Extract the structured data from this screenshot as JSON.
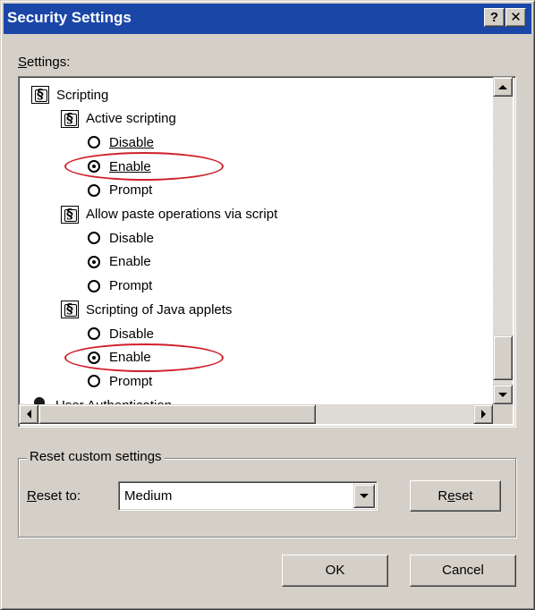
{
  "window": {
    "title": "Security Settings",
    "help_button": "?",
    "close_button": "✕"
  },
  "settings_label": {
    "u": "S",
    "rest": "ettings:"
  },
  "tree": [
    {
      "kind": "category",
      "icon": "script-settings-icon",
      "label": "Scripting"
    },
    {
      "kind": "setting",
      "icon": "script-settings-icon",
      "label": "Active scripting"
    },
    {
      "kind": "option",
      "label": "Disable",
      "underline": "D",
      "checked": false
    },
    {
      "kind": "option",
      "label": "Enable",
      "underline": "E",
      "checked": true,
      "highlighted": true
    },
    {
      "kind": "option",
      "label": "Prompt",
      "underline": "",
      "checked": false
    },
    {
      "kind": "setting",
      "icon": "script-settings-icon",
      "label": "Allow paste operations via script"
    },
    {
      "kind": "option",
      "label": "Disable",
      "underline": "",
      "checked": false
    },
    {
      "kind": "option",
      "label": "Enable",
      "underline": "",
      "checked": true
    },
    {
      "kind": "option",
      "label": "Prompt",
      "underline": "",
      "checked": false
    },
    {
      "kind": "setting",
      "icon": "script-settings-icon",
      "label": "Scripting of Java applets"
    },
    {
      "kind": "option",
      "label": "Disable",
      "underline": "",
      "checked": false
    },
    {
      "kind": "option",
      "label": "Enable",
      "underline": "",
      "checked": true,
      "highlighted": true
    },
    {
      "kind": "option",
      "label": "Prompt",
      "underline": "",
      "checked": false
    },
    {
      "kind": "category",
      "icon": "user-authentication-icon",
      "label": "User Authentication"
    }
  ],
  "reset_group": {
    "legend": "Reset custom settings",
    "reset_to_u": "R",
    "reset_to_rest": "eset to:",
    "selected": "Medium",
    "reset_btn_pre": "R",
    "reset_btn_u": "e",
    "reset_btn_post": "set"
  },
  "buttons": {
    "ok": "OK",
    "cancel": "Cancel"
  },
  "colors": {
    "titlebar": "#1a46a8",
    "highlight": "#d0202a",
    "face": "#d4d0c8"
  }
}
